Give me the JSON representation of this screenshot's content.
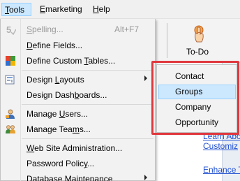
{
  "menubar": {
    "tools_prefix": "",
    "tools_ul": "T",
    "tools_rest": "ools",
    "emk_ul": "E",
    "emk_rest": "marketing",
    "help_ul": "H",
    "help_rest": "elp"
  },
  "toolbar": {
    "todo_label": "To-Do"
  },
  "links": {
    "line1": "Learn Abo",
    "line2": "Customiz",
    "line3": "Enhance T"
  },
  "tools_menu": {
    "items": [
      {
        "ul": "S",
        "rest": "pelling...",
        "shortcut": "Alt+F7"
      },
      {
        "ul": "D",
        "rest": "efine Fields..."
      },
      {
        "pre": "Define Custom ",
        "ul": "T",
        "rest": "ables..."
      },
      {
        "pre": "Design ",
        "ul": "L",
        "rest": "ayouts"
      },
      {
        "pre": "Design Dash",
        "ul": "b",
        "rest": "oards..."
      },
      {
        "pre": "Manage ",
        "ul": "U",
        "rest": "sers..."
      },
      {
        "pre": "Manage Tea",
        "ul": "m",
        "rest": "s..."
      },
      {
        "ul": "W",
        "rest": "eb Site Administration..."
      },
      {
        "pre": "Password Polic",
        "ul": "y",
        "rest": "..."
      },
      {
        "pre": "Data",
        "ul": "b",
        "rest": "ase Maintenance"
      }
    ]
  },
  "layouts_submenu": {
    "items": [
      "Contact",
      "Groups",
      "Company",
      "Opportunity"
    ]
  },
  "colors": {
    "highlight_border": "#e0383e",
    "selection": "#cce8ff",
    "link": "#1f4fd1"
  }
}
